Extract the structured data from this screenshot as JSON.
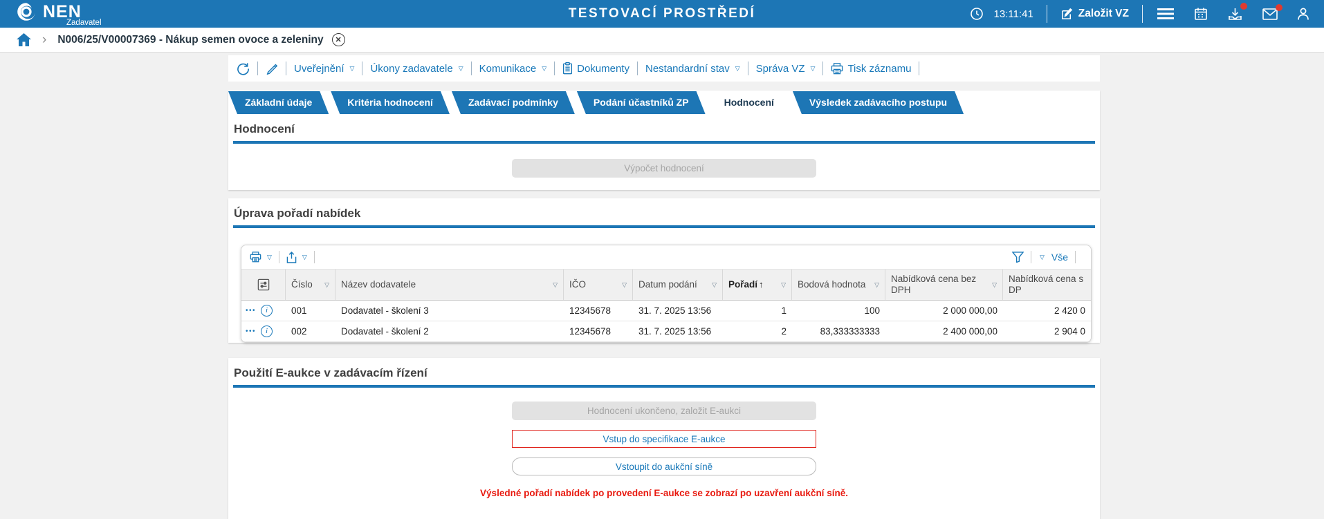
{
  "colors": {
    "accent": "#1d76b5",
    "link": "#1878b9",
    "red": "#e8190f",
    "disabled_text": "#a5a5a5"
  },
  "icons": {
    "dropdown": "▽",
    "sort_asc": "↑",
    "row_menu": "•••",
    "info": "i",
    "breadcrumb_chevron": "›",
    "close": "✕"
  },
  "header": {
    "brand": "NEN",
    "subtitle": "Zadavatel",
    "env_title": "TESTOVACÍ PROSTŘEDÍ",
    "time": "13:11:41",
    "create_vz": "Založit VZ"
  },
  "breadcrumb": {
    "title": "N006/25/V00007369 - Nákup semen ovoce a zeleniny"
  },
  "toolbar": {
    "items": [
      {
        "label": "Uveřejnění"
      },
      {
        "label": "Úkony zadavatele"
      },
      {
        "label": "Komunikace"
      },
      {
        "label": "Dokumenty"
      },
      {
        "label": "Nestandardní stav"
      },
      {
        "label": "Správa VZ"
      },
      {
        "label": "Tisk záznamu"
      }
    ]
  },
  "tabs": [
    {
      "label": "Základní údaje",
      "active": false
    },
    {
      "label": "Kritéria hodnocení",
      "active": false
    },
    {
      "label": "Zadávací podmínky",
      "active": false
    },
    {
      "label": "Podání účastníků ZP",
      "active": false
    },
    {
      "label": "Hodnocení",
      "active": true
    },
    {
      "label": "Výsledek zadávacího postupu",
      "active": false
    }
  ],
  "sections": {
    "hodnoceni": {
      "title": "Hodnocení",
      "compute_button": "Výpočet hodnocení"
    },
    "poradi": {
      "title": "Úprava pořadí nabídek",
      "filter_all": "Vše"
    },
    "eaukce": {
      "title": "Použití E-aukce v zadávacím řízení",
      "finish_button": "Hodnocení ukončeno, založit E-aukci",
      "spec_button": "Vstup do specifikace E-aukce",
      "room_button": "Vstoupit do aukční síně",
      "note": "Výsledné pořadí nabídek po provedení E-aukce se zobrazí po uzavření aukční síně."
    }
  },
  "table": {
    "columns": [
      {
        "label": "Číslo"
      },
      {
        "label": "Název dodavatele"
      },
      {
        "label": "IČO"
      },
      {
        "label": "Datum podání"
      },
      {
        "label": "Pořadí",
        "sorted": "asc"
      },
      {
        "label": "Bodová hodnota"
      },
      {
        "label": "Nabídková cena bez DPH"
      },
      {
        "label": "Nabídková cena s DP"
      }
    ],
    "rows": [
      {
        "cislo": "001",
        "nazev": "Dodavatel - školení 3",
        "ico": "12345678",
        "datum": "31. 7. 2025 13:56",
        "poradi": "1",
        "bodova": "100",
        "cena_bez_dph": "2 000 000,00",
        "cena_s_dph": "2 420 0"
      },
      {
        "cislo": "002",
        "nazev": "Dodavatel - školení 2",
        "ico": "12345678",
        "datum": "31. 7. 2025 13:56",
        "poradi": "2",
        "bodova": "83,333333333",
        "cena_bez_dph": "2 400 000,00",
        "cena_s_dph": "2 904 0"
      }
    ]
  }
}
